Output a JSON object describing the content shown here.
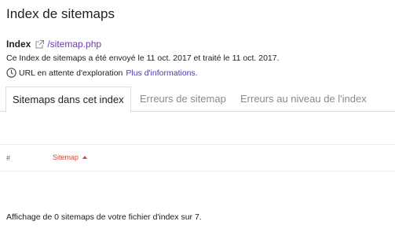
{
  "page": {
    "title": "Index de sitemaps"
  },
  "index": {
    "label": "Index",
    "link_icon": "external-link-icon",
    "link_text": "/sitemap.php"
  },
  "submission": {
    "text": "Ce Index de sitemaps a été envoyé le 11 oct. 2017 et traité le 11 oct. 2017."
  },
  "status": {
    "icon": "clock-icon",
    "text": "URL en attente d'exploration",
    "more_link": "Plus d'informations."
  },
  "tabs": [
    {
      "label": "Sitemaps dans cet index",
      "active": true
    },
    {
      "label": "Erreurs de sitemap",
      "active": false
    },
    {
      "label": "Erreurs au niveau de l'index",
      "active": false
    }
  ],
  "table": {
    "columns": [
      {
        "label": "#"
      },
      {
        "label": "Sitemap",
        "sort_icon": "sort-ascending-icon",
        "color": "#d14836"
      }
    ],
    "rows": []
  },
  "footer": {
    "text": "Affichage de 0 sitemaps de votre fichier d'index sur 7."
  },
  "colors": {
    "link": "#6a3ab2",
    "accent": "#d14836",
    "inactive_tab": "#8a8a8a"
  }
}
